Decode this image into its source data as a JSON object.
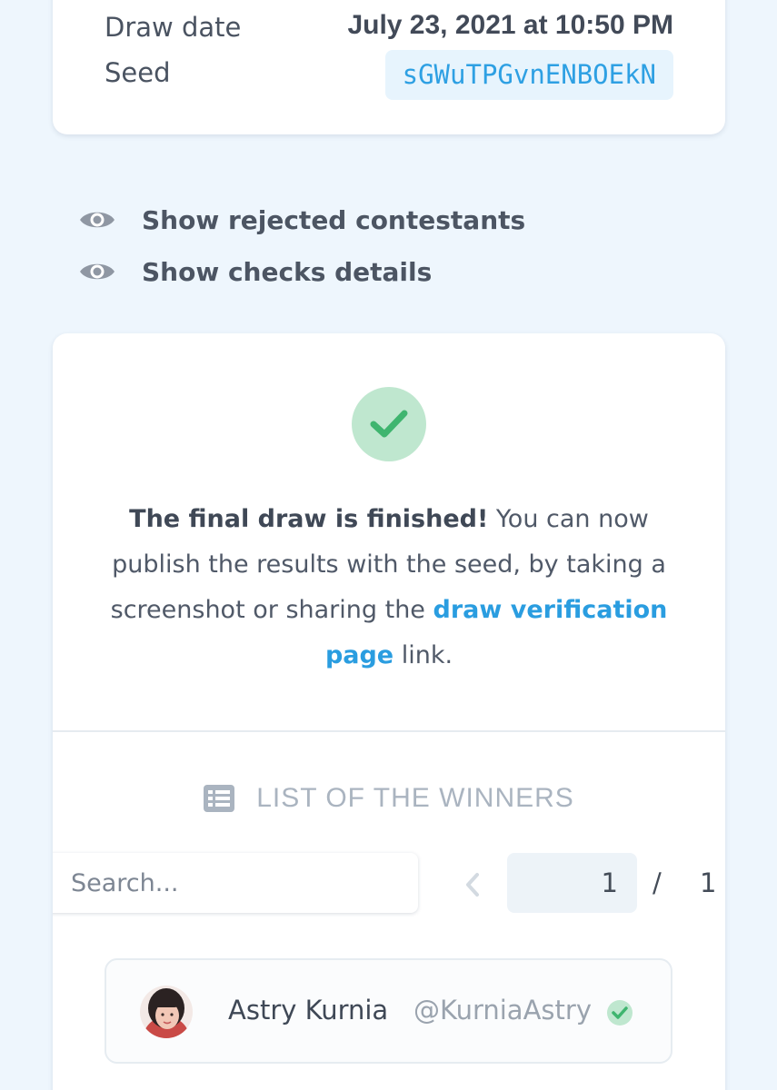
{
  "info": {
    "draw_date_label": "Draw date",
    "draw_date_value": "July 23, 2021 at 10:50 PM",
    "seed_label": "Seed",
    "seed_value": "sGWuTPGvnENBOEkN"
  },
  "toggles": [
    {
      "label": "Show rejected contestants",
      "icon": "eye-icon"
    },
    {
      "label": "Show checks details",
      "icon": "eye-icon"
    }
  ],
  "result": {
    "status_icon": "check-icon",
    "message_bold": "The final draw is finished!",
    "message_text": " You can now publish the results with the seed, by taking a screenshot or sharing the ",
    "message_link": "draw verification page",
    "message_end": " link."
  },
  "winners": {
    "heading": "LIST OF THE WINNERS",
    "heading_icon": "list-icon",
    "search_placeholder": "Search...",
    "current_page": "1",
    "page_separator": "/",
    "total_pages": "1",
    "items": [
      {
        "name": "Astry Kurnia",
        "handle": "@KurniaAstry",
        "verified": true
      }
    ]
  },
  "colors": {
    "background": "#eef6fd",
    "accent": "#2a9de0",
    "success": "#3fb56f",
    "success_bg": "#bfe7cf"
  }
}
